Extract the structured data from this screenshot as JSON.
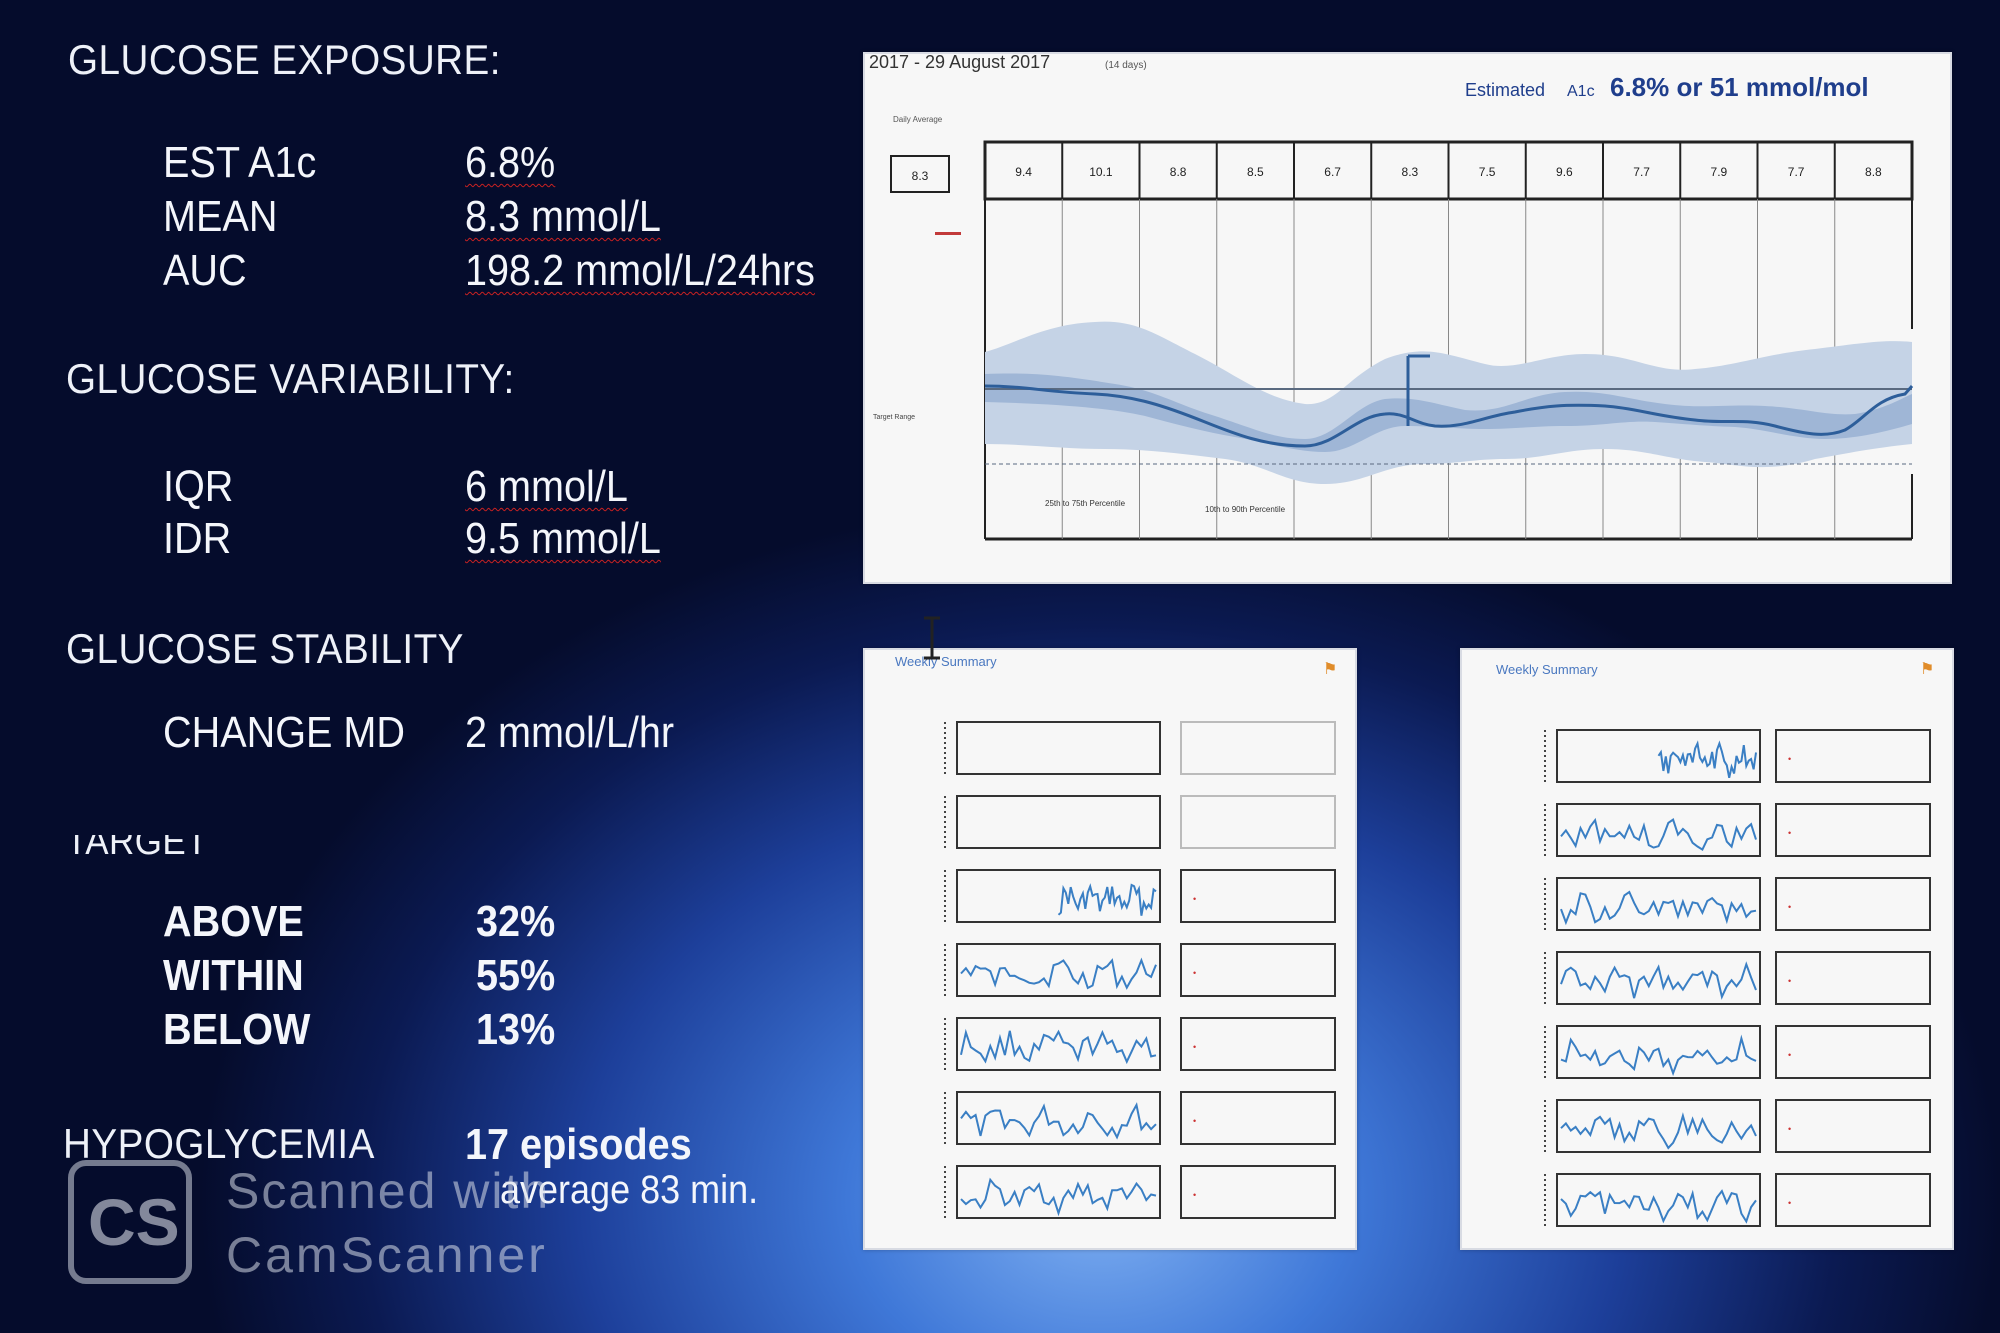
{
  "exposure": {
    "heading": "GLUCOSE EXPOSURE:",
    "rows": [
      {
        "label": "EST A1c",
        "value": "6.8%"
      },
      {
        "label": "MEAN",
        "value": "8.3 mmol/L"
      },
      {
        "label": "AUC",
        "value": "198.2  mmol/L/24hrs"
      }
    ]
  },
  "variability": {
    "heading": "GLUCOSE VARIABILITY:",
    "rows": [
      {
        "label": "IQR",
        "value": "6 mmol/L"
      },
      {
        "label": "IDR",
        "value": "9.5 mmol/L"
      }
    ]
  },
  "stability": {
    "heading": "GLUCOSE STABILITY",
    "change_label": "CHANGE MD",
    "change_value": "2 mmol/L/hr"
  },
  "target": {
    "heading": "TARGET",
    "rows": [
      {
        "label": "ABOVE",
        "value": "32%"
      },
      {
        "label": "WITHIN",
        "value": "55%"
      },
      {
        "label": "BELOW",
        "value": "13%"
      }
    ]
  },
  "hypoglycemia": {
    "label": "HYPOGLYCEMIA",
    "episodes": "17 episodes",
    "average": "average  83  min."
  },
  "main_chart": {
    "date_range": "2017  - 29 August 2017",
    "days": "(14 days)",
    "estimated_label": "Estimated",
    "a1c_label": "A1c",
    "estimate_text": "6.8% or 51 mmol/mol",
    "daily_average_label": "Daily Average",
    "overall_average": "8.3",
    "daily_averages": [
      "9.4",
      "10.1",
      "8.8",
      "8.5",
      "6.7",
      "8.3",
      "7.5",
      "9.6",
      "7.7",
      "7.9",
      "7.7",
      "8.8"
    ],
    "legend_1": "25th to 75th Percentile",
    "legend_2": "10th to 90th Percentile",
    "target_range_label": "Target Range",
    "colors": {
      "band_outer": "#c5d3e6",
      "band_inner": "#9fb6d6",
      "median": "#2d5e9a"
    }
  },
  "weekly_left": {
    "title": "Weekly Summary"
  },
  "weekly_right": {
    "title": "Weekly Summary"
  },
  "watermark": {
    "logo": "CS",
    "line1": "Scanned with",
    "line2": "CamScanner"
  }
}
